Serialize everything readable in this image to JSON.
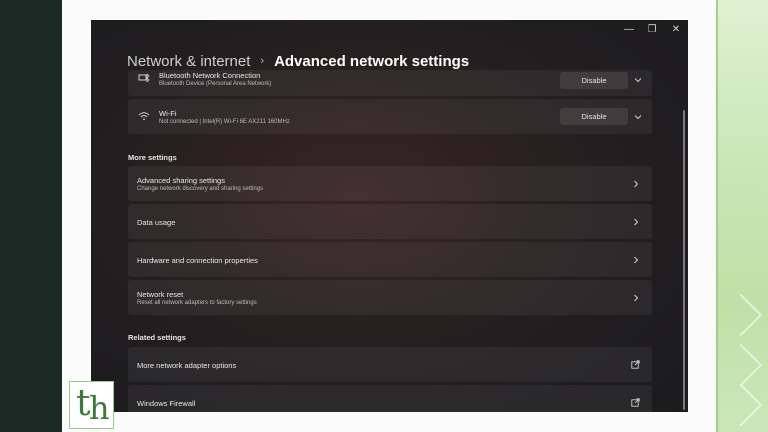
{
  "window": {
    "controls": {
      "minimize": "—",
      "maximize": "❐",
      "close": "✕"
    }
  },
  "breadcrumb": {
    "parent": "Network & internet",
    "separator": "›",
    "current": "Advanced network settings"
  },
  "adapters": [
    {
      "title": "Bluetooth Network Connection",
      "subtitle": "Bluetooth Device (Personal Area Network)",
      "action": "Disable",
      "icon": "bluetooth-network-icon"
    },
    {
      "title": "Wi-Fi",
      "subtitle": "Not connected | Intel(R) Wi-Fi 6E AX211 160MHz",
      "action": "Disable",
      "icon": "wifi-icon"
    }
  ],
  "more_settings": {
    "heading": "More settings",
    "items": [
      {
        "title": "Advanced sharing settings",
        "subtitle": "Change network discovery and sharing settings"
      },
      {
        "title": "Data usage",
        "subtitle": ""
      },
      {
        "title": "Hardware and connection properties",
        "subtitle": ""
      },
      {
        "title": "Network reset",
        "subtitle": "Reset all network adapters to factory settings"
      }
    ]
  },
  "related_settings": {
    "heading": "Related settings",
    "items": [
      {
        "title": "More network adapter options"
      },
      {
        "title": "Windows Firewall"
      }
    ]
  },
  "logo": {
    "text_t": "t",
    "text_h": "h"
  },
  "colors": {
    "accent": "#3d7a3a",
    "window_bg": "#1f1d1f",
    "card_bg": "#2b2627"
  }
}
